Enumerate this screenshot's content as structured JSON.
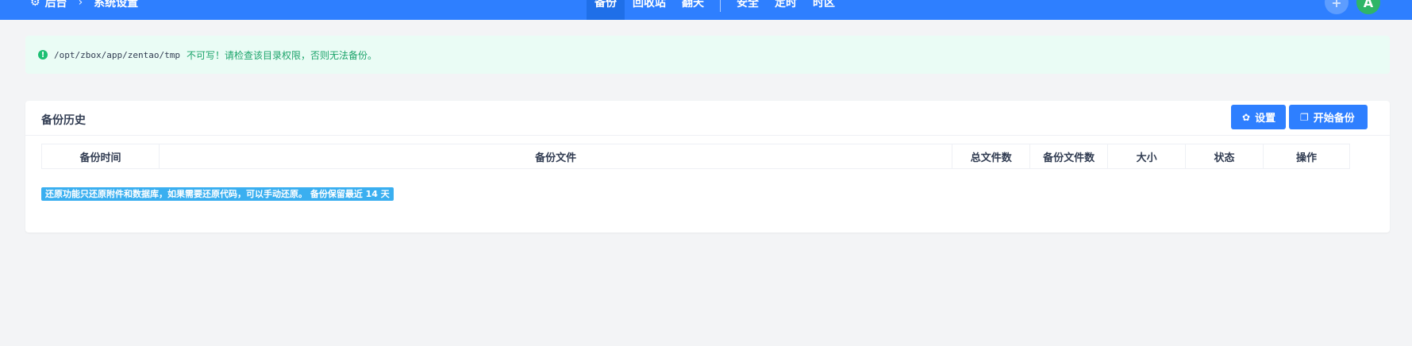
{
  "topbar": {
    "breadcrumb": {
      "home": "后台",
      "current": "系统设置"
    },
    "nav": [
      "备份",
      "回收站",
      "翻天",
      "安全",
      "定时",
      "时区"
    ],
    "active_nav": "备份",
    "avatar_letter": "A",
    "plus_symbol": "+"
  },
  "alert": {
    "path": "/opt/zbox/app/zentao/tmp",
    "message": "不可写！请检查该目录权限，否则无法备份。",
    "icon": "exclamation-circle-icon",
    "color": "#1ba36a",
    "background": "#eafcf5"
  },
  "panel": {
    "title": "备份历史",
    "settings_label": "设置",
    "start_label": "开始备份",
    "columns": [
      "备份时间",
      "备份文件",
      "总文件数",
      "备份文件数",
      "大小",
      "状态",
      "操作"
    ],
    "note": "还原功能只还原附件和数据库，如果需要还原代码，可以手动还原。 备份保留最近 14 天"
  },
  "colors": {
    "primary": "#2e7fff",
    "note_bg": "#3aaff0",
    "page_bg": "#f3f4f6"
  }
}
